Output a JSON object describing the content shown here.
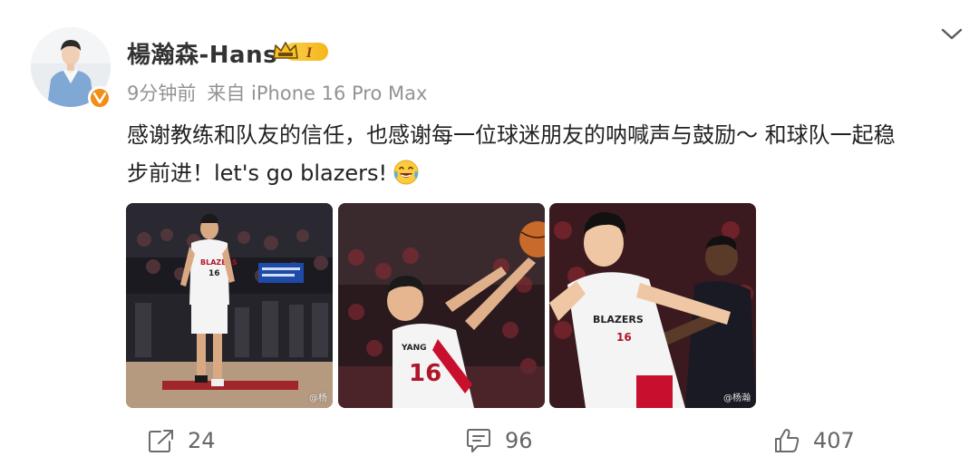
{
  "post": {
    "author": "楊瀚森-Hans",
    "badge_level": "I",
    "time": "9分钟前",
    "source": "来自 iPhone 16 Pro Max",
    "text_line1": "感谢教练和队友的信任，也感谢每一位球迷朋友的呐喊声与鼓励～ 和球队一起稳",
    "text_line2": "步前进！let's go blazers!",
    "photos": [
      {
        "watermark": "@杨"
      },
      {
        "watermark": ""
      },
      {
        "watermark": "@杨瀚"
      }
    ]
  },
  "actions": {
    "share_count": "24",
    "comment_count": "96",
    "like_count": "407"
  },
  "colors": {
    "verified": "#f28d16",
    "badge_gold": "#f5b51c",
    "meta_gray": "#939393",
    "blazers_red": "#c8102e"
  },
  "icons": {
    "verified": "verified-icon",
    "crown": "crown-icon",
    "chevron": "chevron-down-icon",
    "emoji": "laughing-crying-emoji-icon",
    "share": "share-icon",
    "comment": "comment-icon",
    "like": "thumbs-up-icon"
  }
}
